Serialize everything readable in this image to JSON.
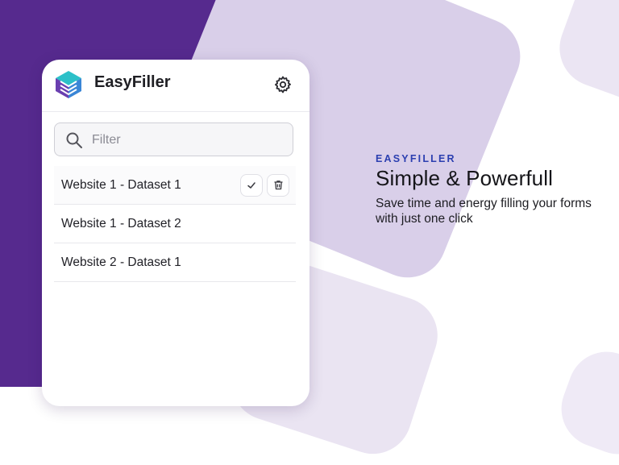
{
  "app": {
    "name": "EasyFiller",
    "logo_icon": "stacked-layers-logo",
    "settings_icon": "gear-icon"
  },
  "filter": {
    "placeholder": "Filter",
    "value": "",
    "icon": "search-icon"
  },
  "datasets": [
    {
      "label": "Website 1 - Dataset 1",
      "active": true
    },
    {
      "label": "Website 1 - Dataset 2",
      "active": false
    },
    {
      "label": "Website 2 - Dataset 1",
      "active": false
    }
  ],
  "row_actions": {
    "apply_icon": "check-icon",
    "delete_icon": "trash-icon"
  },
  "promo": {
    "eyebrow": "EASYFILLER",
    "title": "Simple & Powerfull",
    "subtitle": "Save time and energy filling your forms with just one click"
  },
  "colors": {
    "brand_purple": "#562a8e",
    "accent_blue": "#2b3fb0",
    "logo_teal": "#2cc0c8"
  }
}
